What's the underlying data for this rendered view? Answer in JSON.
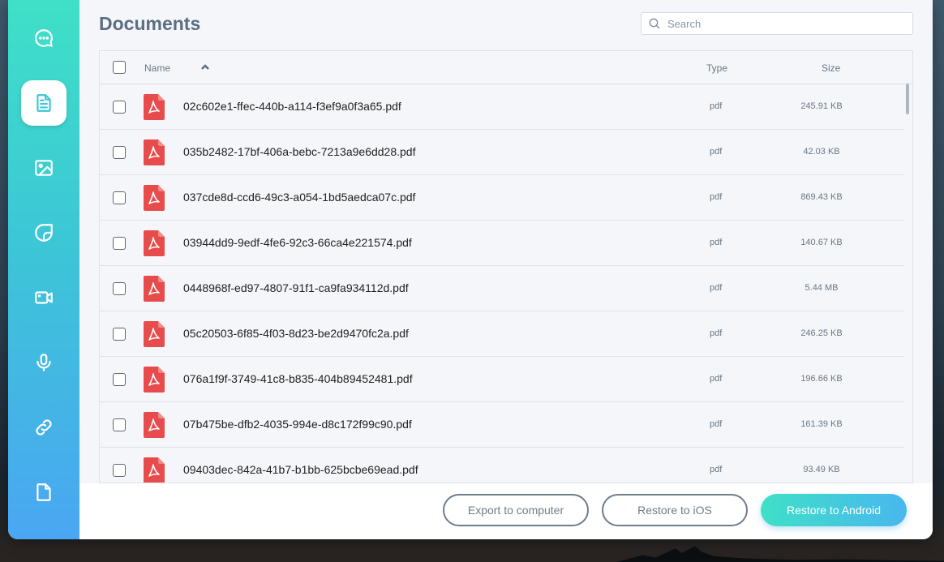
{
  "page": {
    "title": "Documents"
  },
  "search": {
    "placeholder": "Search"
  },
  "sidebar": {
    "items": [
      {
        "name": "messages",
        "icon": "chat-bubble-icon",
        "active": false
      },
      {
        "name": "documents",
        "icon": "document-icon",
        "active": true
      },
      {
        "name": "photos",
        "icon": "image-icon",
        "active": false
      },
      {
        "name": "stickers",
        "icon": "sticker-icon",
        "active": false
      },
      {
        "name": "videos",
        "icon": "video-icon",
        "active": false
      },
      {
        "name": "audio",
        "icon": "microphone-icon",
        "active": false
      },
      {
        "name": "links",
        "icon": "link-icon",
        "active": false
      },
      {
        "name": "files",
        "icon": "file-icon",
        "active": false
      }
    ]
  },
  "table": {
    "columns": {
      "name": "Name",
      "type": "Type",
      "size": "Size"
    },
    "sort": {
      "column": "name",
      "direction": "asc"
    },
    "rows": [
      {
        "name": "02c602e1-ffec-440b-a114-f3ef9a0f3a65.pdf",
        "type": "pdf",
        "size": "245.91 KB"
      },
      {
        "name": "035b2482-17bf-406a-bebc-7213a9e6dd28.pdf",
        "type": "pdf",
        "size": "42.03 KB"
      },
      {
        "name": "037cde8d-ccd6-49c3-a054-1bd5aedca07c.pdf",
        "type": "pdf",
        "size": "869.43 KB"
      },
      {
        "name": "03944dd9-9edf-4fe6-92c3-66ca4e221574.pdf",
        "type": "pdf",
        "size": "140.67 KB"
      },
      {
        "name": "0448968f-ed97-4807-91f1-ca9fa934112d.pdf",
        "type": "pdf",
        "size": "5.44 MB"
      },
      {
        "name": "05c20503-6f85-4f03-8d23-be2d9470fc2a.pdf",
        "type": "pdf",
        "size": "246.25 KB"
      },
      {
        "name": "076a1f9f-3749-41c8-b835-404b89452481.pdf",
        "type": "pdf",
        "size": "196.66 KB"
      },
      {
        "name": "07b475be-dfb2-4035-994e-d8c172f99c90.pdf",
        "type": "pdf",
        "size": "161.39 KB"
      },
      {
        "name": "09403dec-842a-41b7-b1bb-625bcbe69ead.pdf",
        "type": "pdf",
        "size": "93.49 KB"
      }
    ]
  },
  "footer": {
    "export_label": "Export to computer",
    "ios_label": "Restore to iOS",
    "android_label": "Restore to Android"
  },
  "colors": {
    "accent_start": "#3fe0c7",
    "accent_end": "#4aa6f2",
    "pdf_red": "#e84b4b",
    "title": "#5b6e82"
  }
}
